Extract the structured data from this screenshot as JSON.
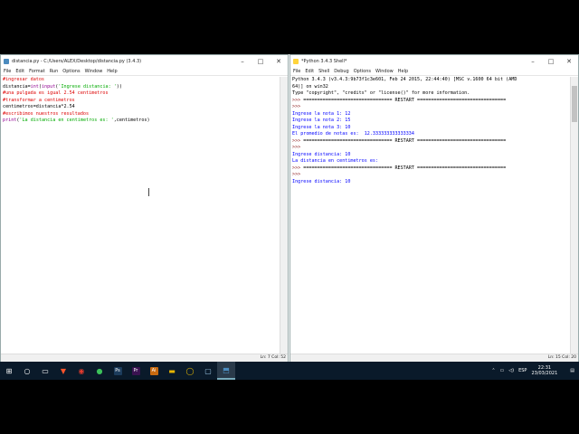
{
  "editor": {
    "title": "distancia.py - C:/Users/ALEX/Desktop/distancia.py (3.4.3)",
    "menu": [
      "File",
      "Edit",
      "Format",
      "Run",
      "Options",
      "Window",
      "Help"
    ],
    "status": "Ln: 7 Col: 52",
    "lines": [
      [
        {
          "c": "comment",
          "t": "#ingresar datos"
        }
      ],
      [
        {
          "c": "",
          "t": "distancia="
        },
        {
          "c": "builtin",
          "t": "int"
        },
        {
          "c": "",
          "t": "("
        },
        {
          "c": "builtin",
          "t": "input"
        },
        {
          "c": "",
          "t": "("
        },
        {
          "c": "str",
          "t": "'Ingrese distancia: '"
        },
        {
          "c": "",
          "t": "))"
        }
      ],
      [
        {
          "c": "comment",
          "t": "#una pulgada es igual 2.54 centimetros"
        }
      ],
      [
        {
          "c": "comment",
          "t": "#transformar a centimetros"
        }
      ],
      [
        {
          "c": "",
          "t": "centimetros=distancia*2.54"
        }
      ],
      [
        {
          "c": "comment",
          "t": "#escribimos nuestros resultados"
        }
      ],
      [
        {
          "c": "builtin",
          "t": "print"
        },
        {
          "c": "",
          "t": "("
        },
        {
          "c": "str",
          "t": "'La distancia en centimetros es: '"
        },
        {
          "c": "",
          "t": ",centimetros)"
        }
      ]
    ]
  },
  "shell": {
    "title": "*Python 3.4.3 Shell*",
    "menu": [
      "File",
      "Edit",
      "Shell",
      "Debug",
      "Options",
      "Window",
      "Help"
    ],
    "status": "Ln: 15 Col: 20",
    "lines": [
      [
        {
          "c": "",
          "t": "Python 3.4.3 (v3.4.3:9b73f1c3e601, Feb 24 2015, 22:44:40) [MSC v.1600 64 bit (AMD"
        }
      ],
      [
        {
          "c": "",
          "t": "64)] on win32"
        }
      ],
      [
        {
          "c": "",
          "t": "Type \"copyright\", \"credits\" or \"license()\" for more information."
        }
      ],
      [
        {
          "c": "prompt",
          "t": ">>> "
        },
        {
          "c": "",
          "t": "================================ RESTART ================================"
        }
      ],
      [
        {
          "c": "prompt",
          "t": ">>> "
        }
      ],
      [
        {
          "c": "out",
          "t": "Ingrese la nota 1: 12"
        }
      ],
      [
        {
          "c": "out",
          "t": "Ingrese la nota 2: 15"
        }
      ],
      [
        {
          "c": "out",
          "t": "Ingrese la nota 3: 10"
        }
      ],
      [
        {
          "c": "out",
          "t": "El promedio de notas es:  12.333333333333334"
        }
      ],
      [
        {
          "c": "prompt",
          "t": ">>> "
        },
        {
          "c": "",
          "t": "================================ RESTART ================================"
        }
      ],
      [
        {
          "c": "prompt",
          "t": ">>> "
        }
      ],
      [
        {
          "c": "out",
          "t": "Ingrese distancia: 10"
        }
      ],
      [
        {
          "c": "out",
          "t": "La distancia en centimetros es:"
        }
      ],
      [
        {
          "c": "prompt",
          "t": ">>> "
        },
        {
          "c": "",
          "t": "================================ RESTART ================================"
        }
      ],
      [
        {
          "c": "prompt",
          "t": ">>> "
        }
      ],
      [
        {
          "c": "out",
          "t": "Ingrese distancia: 10"
        }
      ]
    ]
  },
  "taskbar": {
    "apps": [
      {
        "name": "start-icon",
        "glyph": "⊞",
        "color": "#ffffff"
      },
      {
        "name": "search-icon",
        "glyph": "○",
        "color": "#ffffff"
      },
      {
        "name": "task-view-icon",
        "glyph": "▭",
        "color": "#ffffff"
      },
      {
        "name": "brave-icon",
        "glyph": "▼",
        "color": "#fb542b"
      },
      {
        "name": "chrome-icon",
        "glyph": "◉",
        "color": "#e33b2e"
      },
      {
        "name": "green-app-icon",
        "glyph": "●",
        "color": "#3cc25a"
      },
      {
        "name": "photoshop-icon",
        "glyph": "Ps",
        "color": "#1c3c5c"
      },
      {
        "name": "premiere-icon",
        "glyph": "Pr",
        "color": "#3a1250"
      },
      {
        "name": "illustrator-icon",
        "glyph": "Ai",
        "color": "#c86a10"
      },
      {
        "name": "explorer-icon",
        "glyph": "▬",
        "color": "#e8b500"
      },
      {
        "name": "yellow-app-icon",
        "glyph": "◯",
        "color": "#f0c000"
      },
      {
        "name": "screen-app-icon",
        "glyph": "▢",
        "color": "#9ec8e6"
      },
      {
        "name": "python-icon",
        "glyph": "⬒",
        "color": "#4b8bbe"
      }
    ],
    "tray": {
      "lang": "ESP",
      "time": "22:31",
      "date": "23/03/2021"
    }
  }
}
